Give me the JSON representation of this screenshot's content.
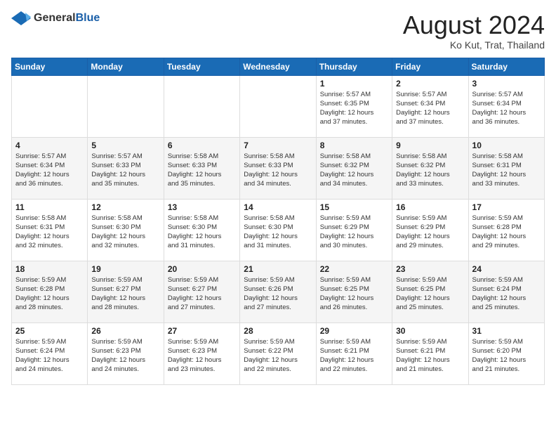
{
  "header": {
    "logo_general": "General",
    "logo_blue": "Blue",
    "month_title": "August 2024",
    "location": "Ko Kut, Trat, Thailand"
  },
  "weekdays": [
    "Sunday",
    "Monday",
    "Tuesday",
    "Wednesday",
    "Thursday",
    "Friday",
    "Saturday"
  ],
  "weeks": [
    {
      "days": [
        {
          "num": "",
          "info": ""
        },
        {
          "num": "",
          "info": ""
        },
        {
          "num": "",
          "info": ""
        },
        {
          "num": "",
          "info": ""
        },
        {
          "num": "1",
          "info": "Sunrise: 5:57 AM\nSunset: 6:35 PM\nDaylight: 12 hours\nand 37 minutes."
        },
        {
          "num": "2",
          "info": "Sunrise: 5:57 AM\nSunset: 6:34 PM\nDaylight: 12 hours\nand 37 minutes."
        },
        {
          "num": "3",
          "info": "Sunrise: 5:57 AM\nSunset: 6:34 PM\nDaylight: 12 hours\nand 36 minutes."
        }
      ]
    },
    {
      "days": [
        {
          "num": "4",
          "info": "Sunrise: 5:57 AM\nSunset: 6:34 PM\nDaylight: 12 hours\nand 36 minutes."
        },
        {
          "num": "5",
          "info": "Sunrise: 5:57 AM\nSunset: 6:33 PM\nDaylight: 12 hours\nand 35 minutes."
        },
        {
          "num": "6",
          "info": "Sunrise: 5:58 AM\nSunset: 6:33 PM\nDaylight: 12 hours\nand 35 minutes."
        },
        {
          "num": "7",
          "info": "Sunrise: 5:58 AM\nSunset: 6:33 PM\nDaylight: 12 hours\nand 34 minutes."
        },
        {
          "num": "8",
          "info": "Sunrise: 5:58 AM\nSunset: 6:32 PM\nDaylight: 12 hours\nand 34 minutes."
        },
        {
          "num": "9",
          "info": "Sunrise: 5:58 AM\nSunset: 6:32 PM\nDaylight: 12 hours\nand 33 minutes."
        },
        {
          "num": "10",
          "info": "Sunrise: 5:58 AM\nSunset: 6:31 PM\nDaylight: 12 hours\nand 33 minutes."
        }
      ]
    },
    {
      "days": [
        {
          "num": "11",
          "info": "Sunrise: 5:58 AM\nSunset: 6:31 PM\nDaylight: 12 hours\nand 32 minutes."
        },
        {
          "num": "12",
          "info": "Sunrise: 5:58 AM\nSunset: 6:30 PM\nDaylight: 12 hours\nand 32 minutes."
        },
        {
          "num": "13",
          "info": "Sunrise: 5:58 AM\nSunset: 6:30 PM\nDaylight: 12 hours\nand 31 minutes."
        },
        {
          "num": "14",
          "info": "Sunrise: 5:58 AM\nSunset: 6:30 PM\nDaylight: 12 hours\nand 31 minutes."
        },
        {
          "num": "15",
          "info": "Sunrise: 5:59 AM\nSunset: 6:29 PM\nDaylight: 12 hours\nand 30 minutes."
        },
        {
          "num": "16",
          "info": "Sunrise: 5:59 AM\nSunset: 6:29 PM\nDaylight: 12 hours\nand 29 minutes."
        },
        {
          "num": "17",
          "info": "Sunrise: 5:59 AM\nSunset: 6:28 PM\nDaylight: 12 hours\nand 29 minutes."
        }
      ]
    },
    {
      "days": [
        {
          "num": "18",
          "info": "Sunrise: 5:59 AM\nSunset: 6:28 PM\nDaylight: 12 hours\nand 28 minutes."
        },
        {
          "num": "19",
          "info": "Sunrise: 5:59 AM\nSunset: 6:27 PM\nDaylight: 12 hours\nand 28 minutes."
        },
        {
          "num": "20",
          "info": "Sunrise: 5:59 AM\nSunset: 6:27 PM\nDaylight: 12 hours\nand 27 minutes."
        },
        {
          "num": "21",
          "info": "Sunrise: 5:59 AM\nSunset: 6:26 PM\nDaylight: 12 hours\nand 27 minutes."
        },
        {
          "num": "22",
          "info": "Sunrise: 5:59 AM\nSunset: 6:25 PM\nDaylight: 12 hours\nand 26 minutes."
        },
        {
          "num": "23",
          "info": "Sunrise: 5:59 AM\nSunset: 6:25 PM\nDaylight: 12 hours\nand 25 minutes."
        },
        {
          "num": "24",
          "info": "Sunrise: 5:59 AM\nSunset: 6:24 PM\nDaylight: 12 hours\nand 25 minutes."
        }
      ]
    },
    {
      "days": [
        {
          "num": "25",
          "info": "Sunrise: 5:59 AM\nSunset: 6:24 PM\nDaylight: 12 hours\nand 24 minutes."
        },
        {
          "num": "26",
          "info": "Sunrise: 5:59 AM\nSunset: 6:23 PM\nDaylight: 12 hours\nand 24 minutes."
        },
        {
          "num": "27",
          "info": "Sunrise: 5:59 AM\nSunset: 6:23 PM\nDaylight: 12 hours\nand 23 minutes."
        },
        {
          "num": "28",
          "info": "Sunrise: 5:59 AM\nSunset: 6:22 PM\nDaylight: 12 hours\nand 22 minutes."
        },
        {
          "num": "29",
          "info": "Sunrise: 5:59 AM\nSunset: 6:21 PM\nDaylight: 12 hours\nand 22 minutes."
        },
        {
          "num": "30",
          "info": "Sunrise: 5:59 AM\nSunset: 6:21 PM\nDaylight: 12 hours\nand 21 minutes."
        },
        {
          "num": "31",
          "info": "Sunrise: 5:59 AM\nSunset: 6:20 PM\nDaylight: 12 hours\nand 21 minutes."
        }
      ]
    }
  ]
}
